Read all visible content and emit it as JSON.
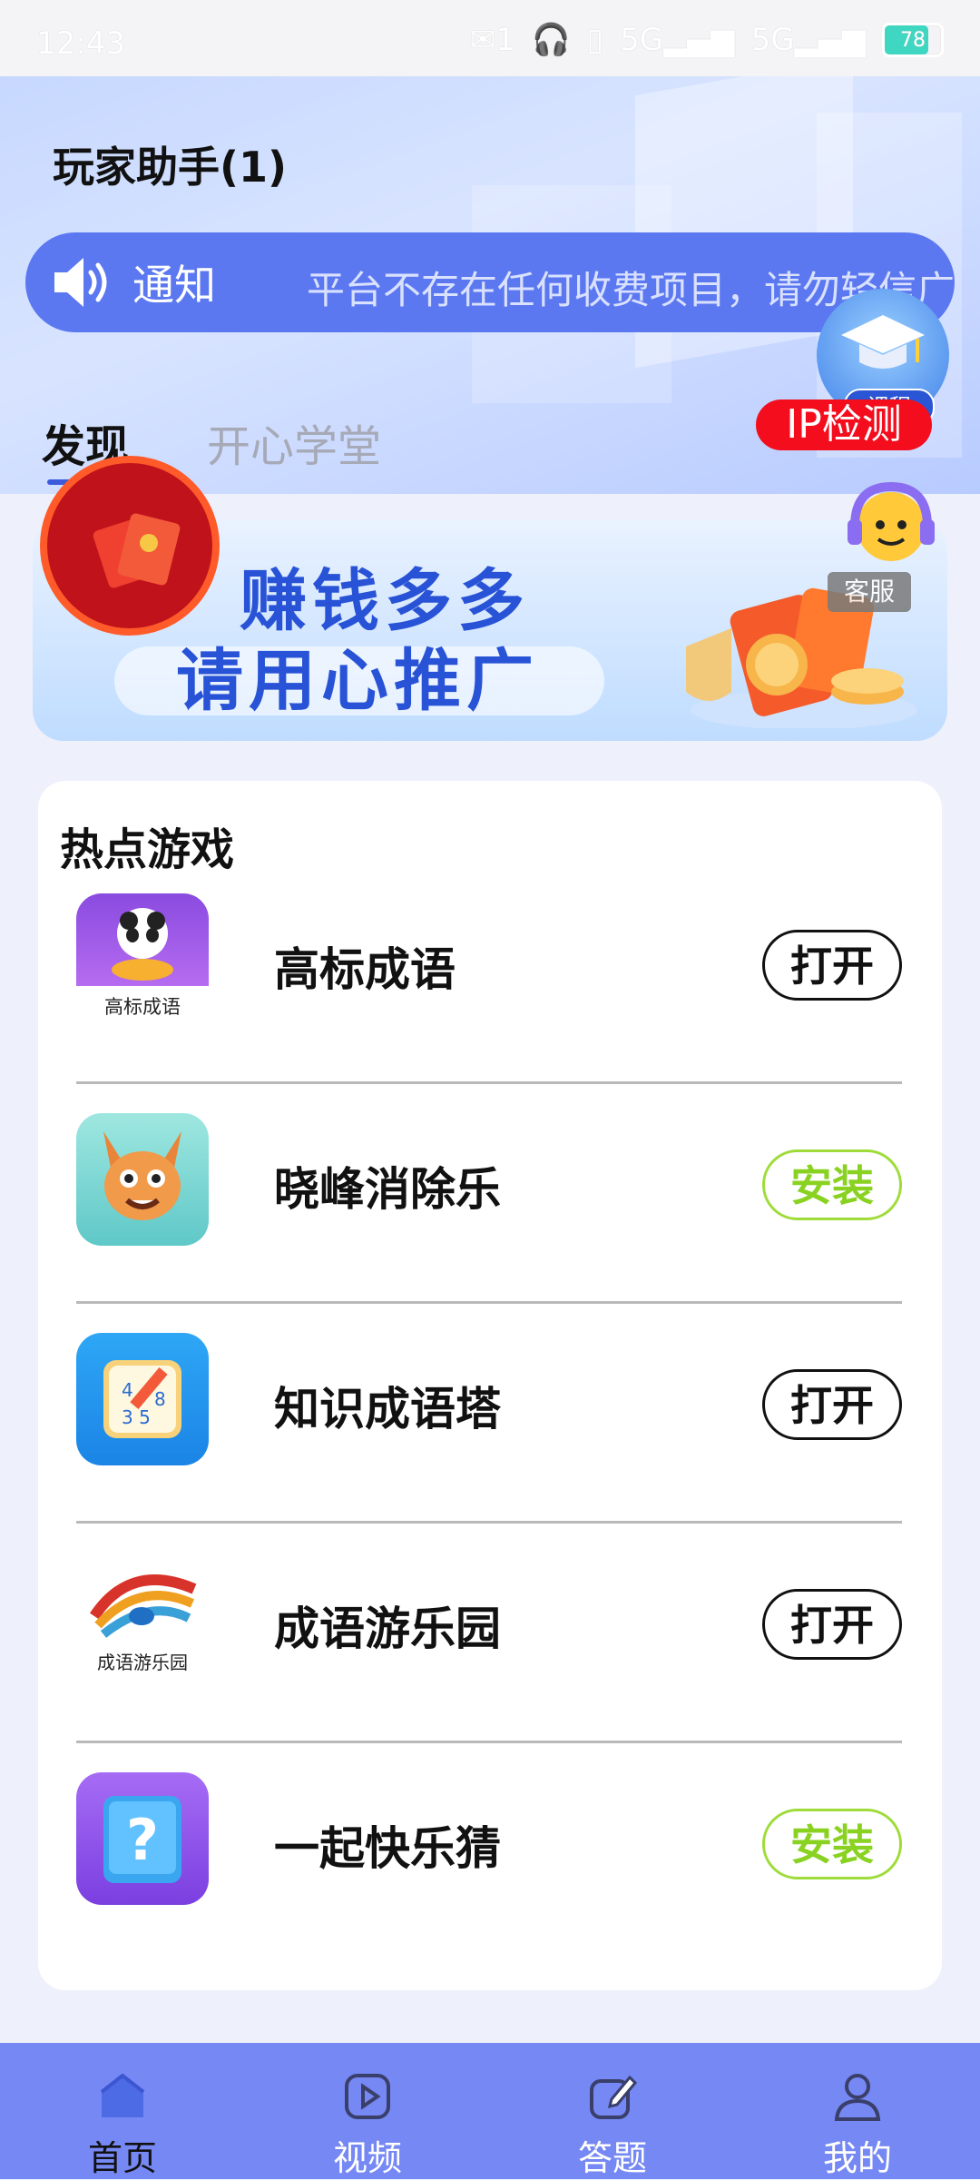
{
  "status_bar": {
    "time": "12:43",
    "notifications": "1",
    "network": "5G",
    "battery": "78"
  },
  "app": {
    "title": "玩家助手(1)"
  },
  "notice": {
    "label": "通知",
    "text": "平台不存在任何收费项目，请勿轻信广"
  },
  "course_badge": {
    "label": "课程"
  },
  "tabs": [
    {
      "label": "发现",
      "active": true
    },
    {
      "label": "开心学堂",
      "active": false
    }
  ],
  "ip_check": {
    "label": "IP检测"
  },
  "banner": {
    "line1": "赚钱多多",
    "line2": "请用心推广",
    "service_label": "客服"
  },
  "hot_games": {
    "title": "热点游戏",
    "items": [
      {
        "name": "高标成语",
        "icon_text": "高标成语",
        "action": "打开",
        "action_type": "open"
      },
      {
        "name": "晓峰消除乐",
        "action": "安装",
        "action_type": "install"
      },
      {
        "name": "知识成语塔",
        "action": "打开",
        "action_type": "open"
      },
      {
        "name": "成语游乐园",
        "icon_text": "成语游乐园",
        "action": "打开",
        "action_type": "open"
      },
      {
        "name": "一起快乐猜",
        "action": "安装",
        "action_type": "install"
      }
    ]
  },
  "bottom_nav": [
    {
      "label": "首页",
      "icon": "home-icon",
      "active": true
    },
    {
      "label": "视频",
      "icon": "video-icon",
      "active": false
    },
    {
      "label": "答题",
      "icon": "quiz-icon",
      "active": false
    },
    {
      "label": "我的",
      "icon": "profile-icon",
      "active": false
    }
  ],
  "colors": {
    "accent": "#5b78f0",
    "nav": "#7588f3",
    "install": "#8ad222",
    "ip_button": "#f30d1d"
  }
}
